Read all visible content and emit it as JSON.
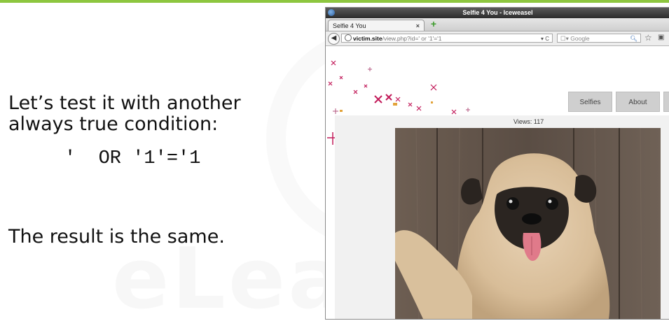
{
  "slide": {
    "line1": "Let’s test it with another",
    "line2": "always true condition:",
    "code": "'  OR '1'='1",
    "result": "The result is the same.",
    "watermark": "eLearn"
  },
  "browser": {
    "window_title": "Selfie 4 You - Iceweasel",
    "tab_label": "Selfie 4 You",
    "tab_close": "×",
    "new_tab": "+",
    "url_host": "victim.site",
    "url_rest": "/view.php?id=' or '1'='1",
    "search_placeholder": "Google"
  },
  "page": {
    "nav": [
      "Selfies",
      "About",
      ""
    ],
    "views_label": "Views:",
    "views_count": "117"
  },
  "colors": {
    "accent_bar": "#8dc63f"
  }
}
